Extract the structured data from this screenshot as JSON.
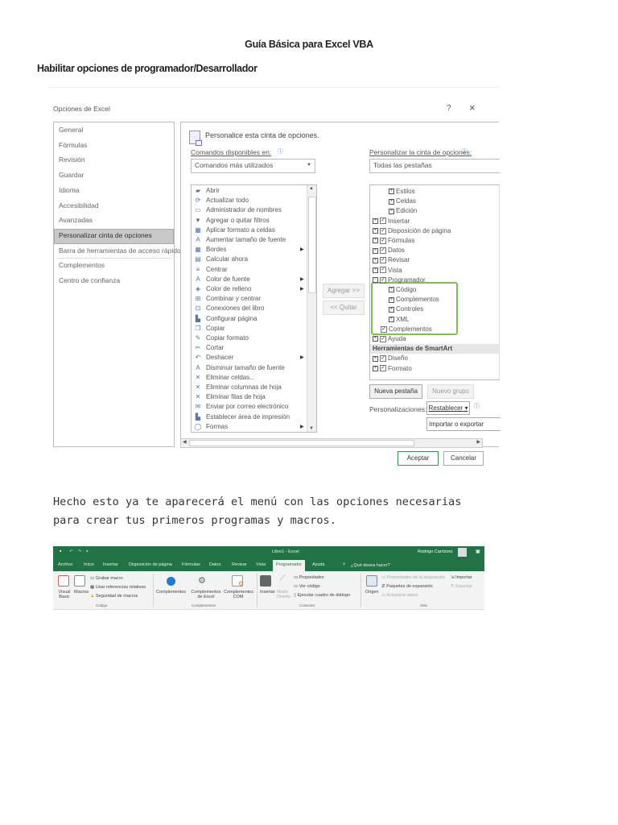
{
  "document": {
    "title": "Guía Básica para Excel VBA",
    "section": "Habilitar opciones de programador/Desarrollador",
    "paragraph": [
      "Hecho esto ya te aparecerá el menú con las opciones necesarias",
      "para crear tus primeros programas y macros."
    ]
  },
  "dialog": {
    "title": "Opciones de Excel",
    "help": "?",
    "close": "×",
    "nav": [
      "General",
      "Fórmulas",
      "Revisión",
      "Guardar",
      "Idioma",
      "Accesibilidad",
      "Avanzadas",
      "Personalizar cinta de opciones",
      "Barra de herramientas de acceso rápido",
      "Complementos",
      "Centro de confianza"
    ],
    "nav_selected": 7,
    "heading": "Personalice esta cinta de opciones.",
    "commands_label": "Comandos disponibles en:",
    "commands_value": "Comandos más utilizados",
    "ribbon_label": "Personalizar la cinta de opciones:",
    "ribbon_value": "Todas las pestañas",
    "commands": [
      {
        "label": "Abrir",
        "icon": "folder-icon",
        "g": "▰"
      },
      {
        "label": "Actualizar todo",
        "icon": "refresh-icon",
        "g": "⟳"
      },
      {
        "label": "Administrador de nombres",
        "icon": "names-icon",
        "g": "▭"
      },
      {
        "label": "Agregar o quitar filtros",
        "icon": "filter-icon",
        "g": "▼"
      },
      {
        "label": "Aplicar formato a celdas",
        "icon": "format-cells-icon",
        "g": "▦"
      },
      {
        "label": "Aumentar tamaño de fuente",
        "icon": "font-grow-icon",
        "g": "A"
      },
      {
        "label": "Bordes",
        "icon": "borders-icon",
        "g": "▦",
        "sub": true
      },
      {
        "label": "Calcular ahora",
        "icon": "calculator-icon",
        "g": "▤"
      },
      {
        "label": "Centrar",
        "icon": "center-icon",
        "g": "≡"
      },
      {
        "label": "Color de fuente",
        "icon": "font-color-icon",
        "g": "A",
        "sub": true
      },
      {
        "label": "Color de relleno",
        "icon": "fill-color-icon",
        "g": "◈",
        "sub": true
      },
      {
        "label": "Combinar y centrar",
        "icon": "merge-icon",
        "g": "⊞"
      },
      {
        "label": "Conexiones del libro",
        "icon": "connections-icon",
        "g": "⊡"
      },
      {
        "label": "Configurar página",
        "icon": "page-setup-icon",
        "g": "▙"
      },
      {
        "label": "Copiar",
        "icon": "copy-icon",
        "g": "❐"
      },
      {
        "label": "Copiar formato",
        "icon": "format-painter-icon",
        "g": "✎"
      },
      {
        "label": "Cortar",
        "icon": "cut-icon",
        "g": "✂"
      },
      {
        "label": "Deshacer",
        "icon": "undo-icon",
        "g": "↶",
        "sub": true
      },
      {
        "label": "Disminuir tamaño de fuente",
        "icon": "font-shrink-icon",
        "g": "A"
      },
      {
        "label": "Eliminar celdas...",
        "icon": "delete-cells-icon",
        "g": "✕"
      },
      {
        "label": "Eliminar columnas de hoja",
        "icon": "delete-columns-icon",
        "g": "✕"
      },
      {
        "label": "Eliminar filas de hoja",
        "icon": "delete-rows-icon",
        "g": "✕"
      },
      {
        "label": "Enviar por correo electrónico",
        "icon": "email-icon",
        "g": "✉"
      },
      {
        "label": "Establecer área de impresión",
        "icon": "print-area-icon",
        "g": "▙"
      },
      {
        "label": "Formas",
        "icon": "shapes-icon",
        "g": "◯",
        "sub": true
      }
    ],
    "add_button": "Agregar >>",
    "remove_button": "<< Quitar",
    "tree": [
      {
        "label": "Estilos",
        "level": 2,
        "pm": "+"
      },
      {
        "label": "Celdas",
        "level": 2,
        "pm": "+"
      },
      {
        "label": "Edición",
        "level": 2,
        "pm": "+"
      },
      {
        "label": "Insertar",
        "level": 0,
        "pm": "+",
        "cb": true
      },
      {
        "label": "Disposición de página",
        "level": 0,
        "pm": "+",
        "cb": true
      },
      {
        "label": "Fórmulas",
        "level": 0,
        "pm": "+",
        "cb": true
      },
      {
        "label": "Datos",
        "level": 0,
        "pm": "+",
        "cb": true
      },
      {
        "label": "Revisar",
        "level": 0,
        "pm": "+",
        "cb": true
      },
      {
        "label": "Vista",
        "level": 0,
        "pm": "+",
        "cb": true
      },
      {
        "label": "Programador",
        "level": 0,
        "pm": "−",
        "cb": true
      },
      {
        "label": "Código",
        "level": 2,
        "pm": "+"
      },
      {
        "label": "Complementos",
        "level": 2,
        "pm": "+"
      },
      {
        "label": "Controles",
        "level": 2,
        "pm": "+"
      },
      {
        "label": "XML",
        "level": 2,
        "pm": "+"
      },
      {
        "label": "Complementos",
        "level": 1,
        "cb": true
      },
      {
        "label": "Ayuda",
        "level": 0,
        "pm": "+",
        "cb": true
      },
      {
        "label": "Herramientas de SmartArt",
        "level": -1
      },
      {
        "label": "Diseño",
        "level": 0,
        "pm": "+",
        "cb": true
      },
      {
        "label": "Formato",
        "level": 0,
        "pm": "+",
        "cb": true
      }
    ],
    "highlight_color": "#7dc04f",
    "new_tab": "Nueva pestaña",
    "new_group": "Nuevo grupo",
    "customizations_label": "Personalizaciones:",
    "reset": "Restablecer",
    "import_export": "Importar o exportar",
    "ok": "Aceptar",
    "cancel": "Cancelar"
  },
  "ribbon": {
    "window_title": "Libro1 - Excel",
    "user": "Rodrigo Carrizoro",
    "accent": "#217346",
    "tabs": [
      "Archivo",
      "Inicio",
      "Insertar",
      "Disposición de página",
      "Fórmulas",
      "Datos",
      "Revisar",
      "Vista",
      "Programador",
      "Ayuda"
    ],
    "active_tab": "Programador",
    "tell_me": "¿Qué desea hacer?",
    "codigo": {
      "visual_basic": "Visual Basic",
      "macros": "Macros",
      "record": "Grabar macro",
      "relative": "Usar referencias relativas",
      "security": "Seguridad de macros",
      "label": "Código"
    },
    "complementos": {
      "c1": "Complementos",
      "c2": "Complementos de Excel",
      "c3": "Complementos COM",
      "label": "Complementos"
    },
    "controles": {
      "insert": "Insertar",
      "design": "Modo Diseño",
      "props": "Propiedades",
      "code": "Ver código",
      "dialog": "Ejecutar cuadro de diálogo",
      "label": "Controles"
    },
    "xml": {
      "source": "Origen",
      "map_props": "Propiedades de la asignación",
      "packs": "Paquetes de expansión",
      "refresh": "Actualizar datos",
      "import": "Importar",
      "export": "Exportar",
      "label": "XML"
    }
  }
}
